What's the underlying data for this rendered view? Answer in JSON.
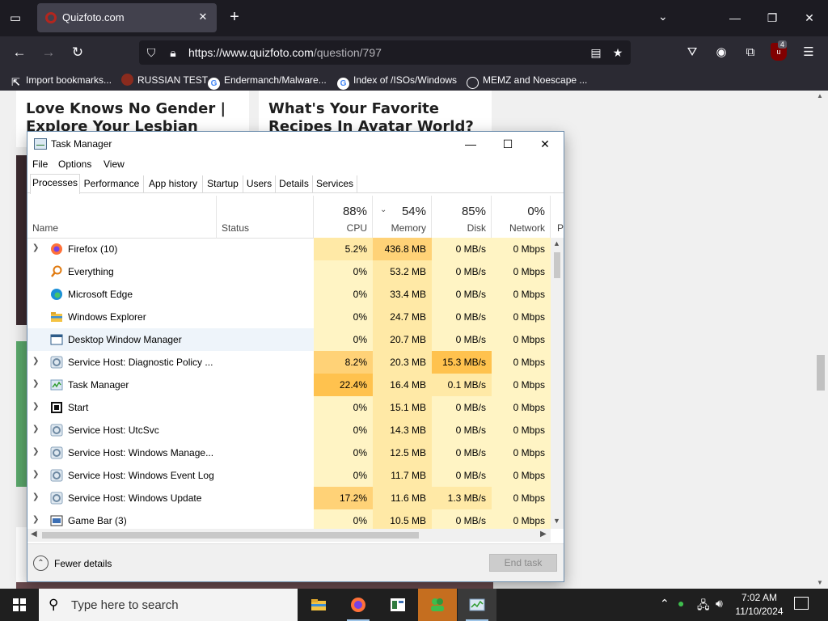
{
  "browser": {
    "tab_title": "Quizfoto.com",
    "url_host": "https://www.quizfoto.com",
    "url_path": "/question/797",
    "bookmarks": [
      {
        "label": "Import bookmarks...",
        "icon": "import-icon"
      },
      {
        "label": "RUSSIAN TEST",
        "icon": "site-favicon"
      },
      {
        "label": "Endermanch/Malware...",
        "icon": "google-icon"
      },
      {
        "label": "Index of /ISOs/Windows",
        "icon": "google-icon"
      },
      {
        "label": "MEMZ and Noescape ...",
        "icon": "globe-icon"
      }
    ],
    "extension_badge": "4"
  },
  "webpage": {
    "card1_title": "Love Knows No Gender | Explore Your Lesbian Identity",
    "card2_title": "What's Your Favorite Recipes In Avatar World?"
  },
  "taskmanager": {
    "title": "Task Manager",
    "menu": [
      "File",
      "Options",
      "View"
    ],
    "tabs": [
      "Processes",
      "Performance",
      "App history",
      "Startup",
      "Users",
      "Details",
      "Services"
    ],
    "columns": {
      "name": "Name",
      "status": "Status",
      "cpu": {
        "pct": "88%",
        "label": "CPU"
      },
      "memory": {
        "pct": "54%",
        "label": "Memory"
      },
      "disk": {
        "pct": "85%",
        "label": "Disk"
      },
      "network": {
        "pct": "0%",
        "label": "Network"
      },
      "power": "P"
    },
    "processes": [
      {
        "name": "Firefox (10)",
        "cpu": "5.2%",
        "memory": "436.8 MB",
        "disk": "0 MB/s",
        "network": "0 Mbps",
        "expandable": true,
        "icon": "firefox-icon"
      },
      {
        "name": "Everything",
        "cpu": "0%",
        "memory": "53.2 MB",
        "disk": "0 MB/s",
        "network": "0 Mbps",
        "expandable": false,
        "icon": "search-icon"
      },
      {
        "name": "Microsoft Edge",
        "cpu": "0%",
        "memory": "33.4 MB",
        "disk": "0 MB/s",
        "network": "0 Mbps",
        "expandable": false,
        "icon": "edge-icon"
      },
      {
        "name": "Windows Explorer",
        "cpu": "0%",
        "memory": "24.7 MB",
        "disk": "0 MB/s",
        "network": "0 Mbps",
        "expandable": false,
        "icon": "folder-icon"
      },
      {
        "name": "Desktop Window Manager",
        "cpu": "0%",
        "memory": "20.7 MB",
        "disk": "0 MB/s",
        "network": "0 Mbps",
        "expandable": false,
        "icon": "window-icon"
      },
      {
        "name": "Service Host: Diagnostic Policy ...",
        "cpu": "8.2%",
        "memory": "20.3 MB",
        "disk": "15.3 MB/s",
        "network": "0 Mbps",
        "expandable": true,
        "icon": "gear-icon"
      },
      {
        "name": "Task Manager",
        "cpu": "22.4%",
        "memory": "16.4 MB",
        "disk": "0.1 MB/s",
        "network": "0 Mbps",
        "expandable": true,
        "icon": "taskmanager-icon"
      },
      {
        "name": "Start",
        "cpu": "0%",
        "memory": "15.1 MB",
        "disk": "0 MB/s",
        "network": "0 Mbps",
        "expandable": true,
        "icon": "start-icon"
      },
      {
        "name": "Service Host: UtcSvc",
        "cpu": "0%",
        "memory": "14.3 MB",
        "disk": "0 MB/s",
        "network": "0 Mbps",
        "expandable": true,
        "icon": "gear-icon"
      },
      {
        "name": "Service Host: Windows Manage...",
        "cpu": "0%",
        "memory": "12.5 MB",
        "disk": "0 MB/s",
        "network": "0 Mbps",
        "expandable": true,
        "icon": "gear-icon"
      },
      {
        "name": "Service Host: Windows Event Log",
        "cpu": "0%",
        "memory": "11.7 MB",
        "disk": "0 MB/s",
        "network": "0 Mbps",
        "expandable": true,
        "icon": "gear-icon"
      },
      {
        "name": "Service Host: Windows Update",
        "cpu": "17.2%",
        "memory": "11.6 MB",
        "disk": "1.3 MB/s",
        "network": "0 Mbps",
        "expandable": true,
        "icon": "gear-icon"
      },
      {
        "name": "Game Bar (3)",
        "cpu": "0%",
        "memory": "10.5 MB",
        "disk": "0 MB/s",
        "network": "0 Mbps",
        "expandable": true,
        "icon": "gamebar-icon"
      }
    ],
    "footer": {
      "fewer_details": "Fewer details",
      "end_task": "End task"
    }
  },
  "taskbar": {
    "search_placeholder": "Type here to search",
    "time": "7:02 AM",
    "date": "11/10/2024"
  },
  "colors": {
    "heat_0": "#fff4c4",
    "heat_1": "#ffe9a6",
    "heat_2": "#ffd277",
    "heat_3": "#ffc24e",
    "selected_row": "#eef4fa",
    "browser_dark": "#1c1b22",
    "star_accent": "#54ffbd"
  }
}
